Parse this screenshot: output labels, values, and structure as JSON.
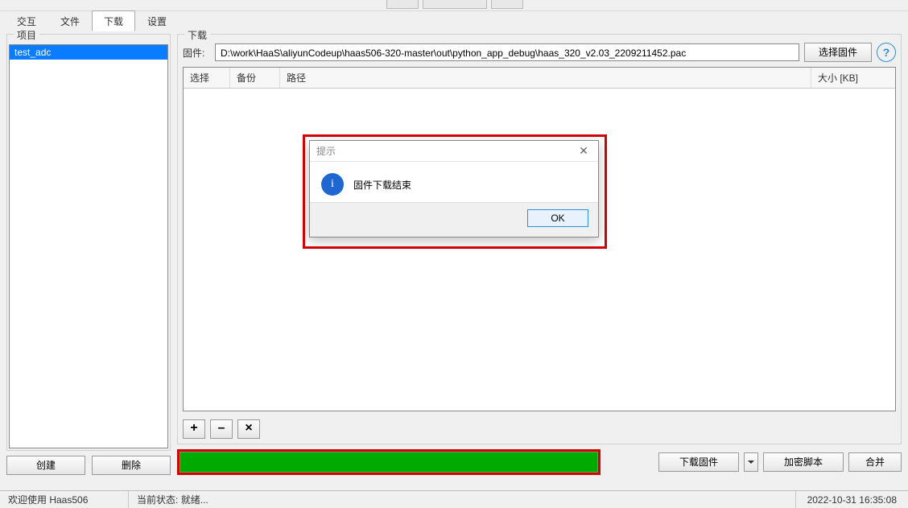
{
  "tabs": [
    "交互",
    "文件",
    "下载",
    "设置"
  ],
  "active_tab_index": 2,
  "left": {
    "group_title": "项目",
    "items": [
      "test_adc"
    ],
    "selected_index": 0,
    "buttons": {
      "create": "创建",
      "delete": "删除"
    }
  },
  "right": {
    "group_title": "下载",
    "firmware_label": "固件:",
    "firmware_path": "D:\\work\\HaaS\\aliyunCodeup\\haas506-320-master\\out\\python_app_debug\\haas_320_v2.03_2209211452.pac",
    "select_firmware_btn": "选择固件",
    "columns": {
      "select": "选择",
      "backup": "备份",
      "path": "路径",
      "size": "大小 [KB]"
    },
    "toolbar": {
      "plus": "+",
      "minus": "–",
      "close": "×"
    },
    "actions": {
      "download": "下载固件",
      "encrypt": "加密脚本",
      "merge": "合并"
    }
  },
  "dialog": {
    "title": "提示",
    "message": "固件下载结束",
    "ok": "OK"
  },
  "status": {
    "welcome": "欢迎使用 Haas506",
    "state_label": "当前状态:",
    "state_value": "就绪...",
    "time": "2022-10-31 16:35:08"
  }
}
